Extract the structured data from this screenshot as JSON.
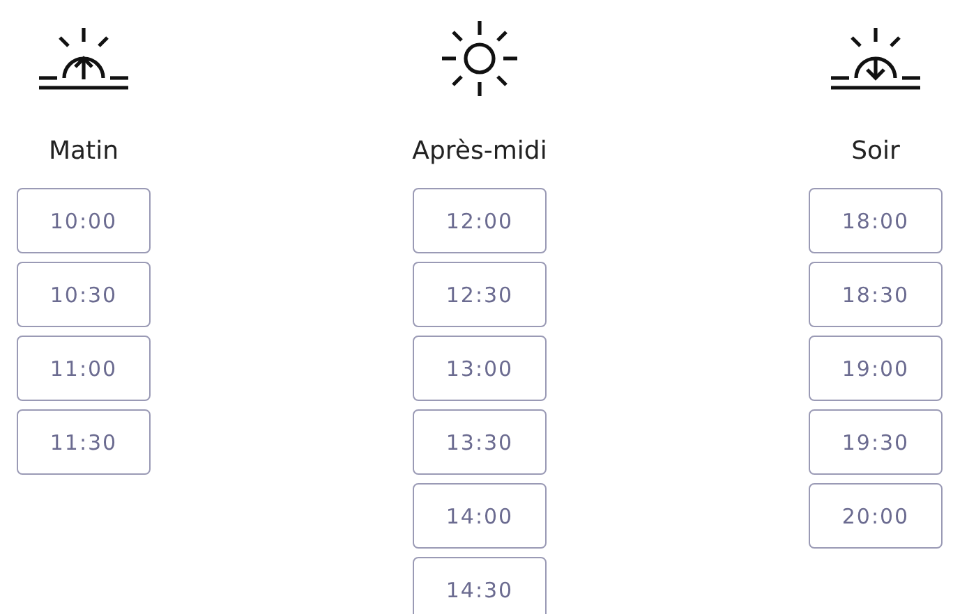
{
  "periods": [
    {
      "kind": "sunrise",
      "label": "Matin",
      "slots": [
        "10:00",
        "10:30",
        "11:00",
        "11:30"
      ]
    },
    {
      "kind": "sun",
      "label": "Après-midi",
      "slots": [
        "12:00",
        "12:30",
        "13:00",
        "13:30",
        "14:00",
        "14:30"
      ]
    },
    {
      "kind": "sunset",
      "label": "Soir",
      "slots": [
        "18:00",
        "18:30",
        "19:00",
        "19:30",
        "20:00"
      ]
    }
  ]
}
